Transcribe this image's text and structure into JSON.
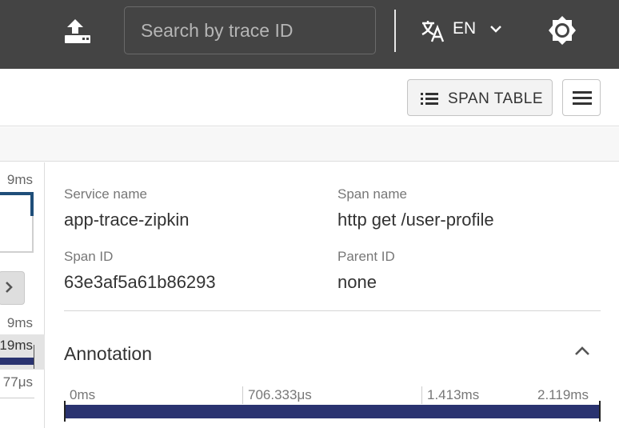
{
  "header": {
    "search_placeholder": "Search by trace ID",
    "language_code": "EN",
    "icons": [
      "upload-icon",
      "translate-icon",
      "chevron-down-icon",
      "brightness-icon"
    ]
  },
  "toolbar": {
    "span_table_label": "SPAN TABLE",
    "icons": [
      "list-icon",
      "hamburger-menu-icon"
    ]
  },
  "left_pane": {
    "top_time": "9ms",
    "mid_time": "9ms",
    "selected_time": "19ms",
    "row_time": "77μs"
  },
  "span_detail": {
    "service_name_label": "Service name",
    "service_name": "app-trace-zipkin",
    "span_name_label": "Span name",
    "span_name": "http get /user-profile",
    "span_id_label": "Span ID",
    "span_id": "63e3af5a61b86293",
    "parent_id_label": "Parent ID",
    "parent_id": "none"
  },
  "annotation": {
    "title": "Annotation",
    "ticks": [
      "0ms",
      "706.333μs",
      "1.413ms",
      "2.119ms"
    ]
  },
  "colors": {
    "header_bg": "#444444",
    "span_bar": "#2a3370",
    "accent": "#1f4e79"
  }
}
